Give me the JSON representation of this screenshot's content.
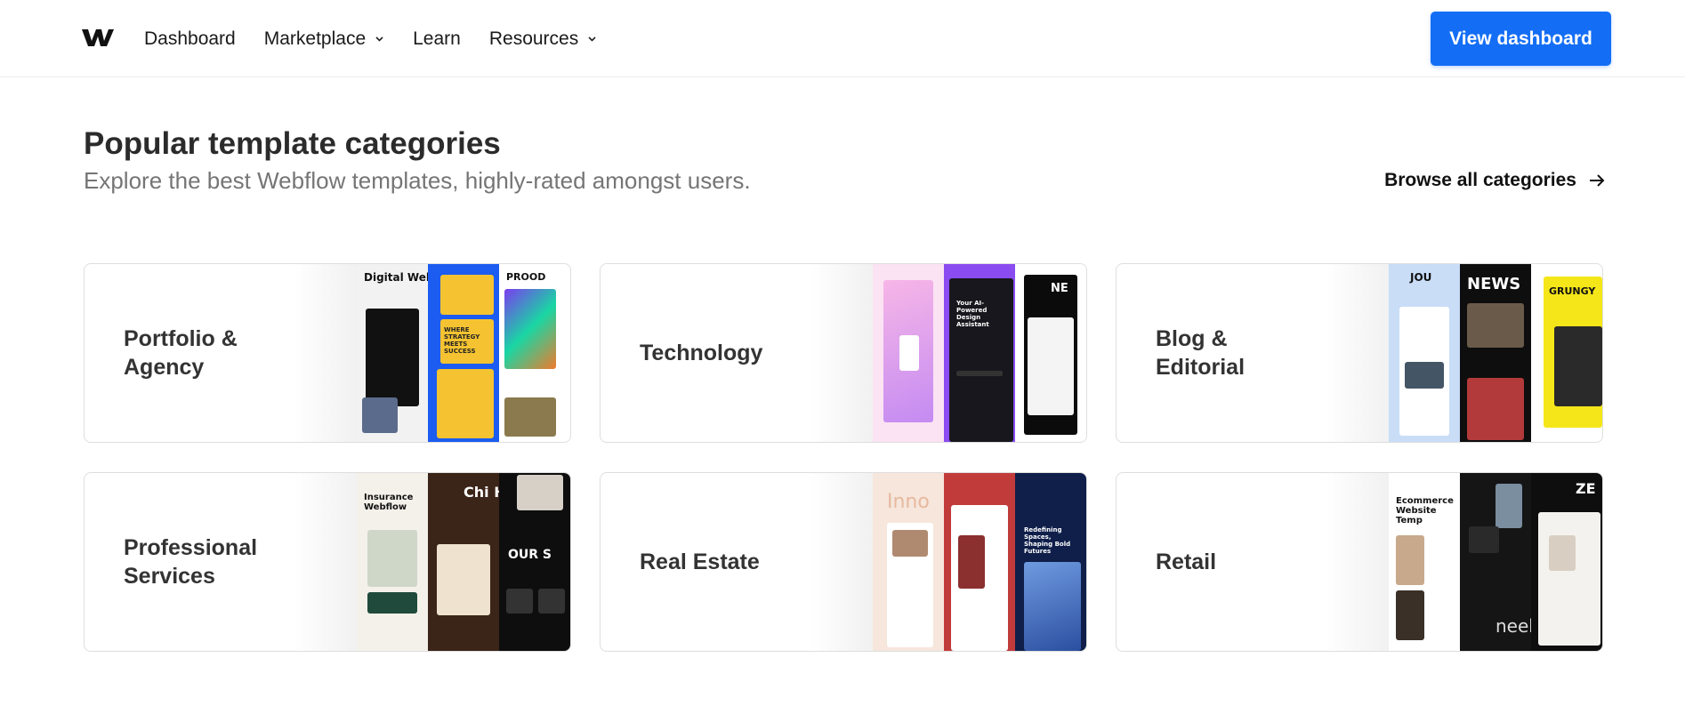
{
  "header": {
    "nav": [
      {
        "label": "Dashboard",
        "dropdown": false
      },
      {
        "label": "Marketplace",
        "dropdown": true
      },
      {
        "label": "Learn",
        "dropdown": false
      },
      {
        "label": "Resources",
        "dropdown": true
      }
    ],
    "cta_label": "View dashboard"
  },
  "section": {
    "title": "Popular template categories",
    "subtitle": "Explore the best Webflow templates, highly-rated amongst users.",
    "browse_label": "Browse all categories"
  },
  "categories": [
    {
      "line1": "Portfolio &",
      "line2": "Agency",
      "thumb_words": [
        "Digital Website",
        "WHERE STRATEGY MEETS SUCCESS",
        "PROOD"
      ]
    },
    {
      "line1": "Technology",
      "line2": "",
      "thumb_words": [
        "",
        "Your AI-Powered Design Assistant",
        "NE"
      ]
    },
    {
      "line1": "Blog &",
      "line2": "Editorial",
      "thumb_words": [
        "JOU",
        "NEWS",
        "GRUNGY"
      ]
    },
    {
      "line1": "Professional",
      "line2": "Services",
      "thumb_words": [
        "Insurance Webflow",
        "Chi Hair Salon We",
        "OUR S"
      ]
    },
    {
      "line1": "Real Estate",
      "line2": "",
      "thumb_words": [
        "Inno",
        "",
        "Redefining Spaces, Shaping Bold Futures"
      ]
    },
    {
      "line1": "Retail",
      "line2": "",
      "thumb_words": [
        "Ecommerce Website Temp",
        "neeb",
        "ZE"
      ]
    }
  ],
  "colors": {
    "accent": "#146ef5",
    "text": "#1a1a1a",
    "muted": "#757575",
    "border": "#dedede"
  },
  "icons": {
    "logo": "webflow-logo-icon",
    "dropdown": "chevron-down-icon",
    "browse": "arrow-right-icon"
  }
}
